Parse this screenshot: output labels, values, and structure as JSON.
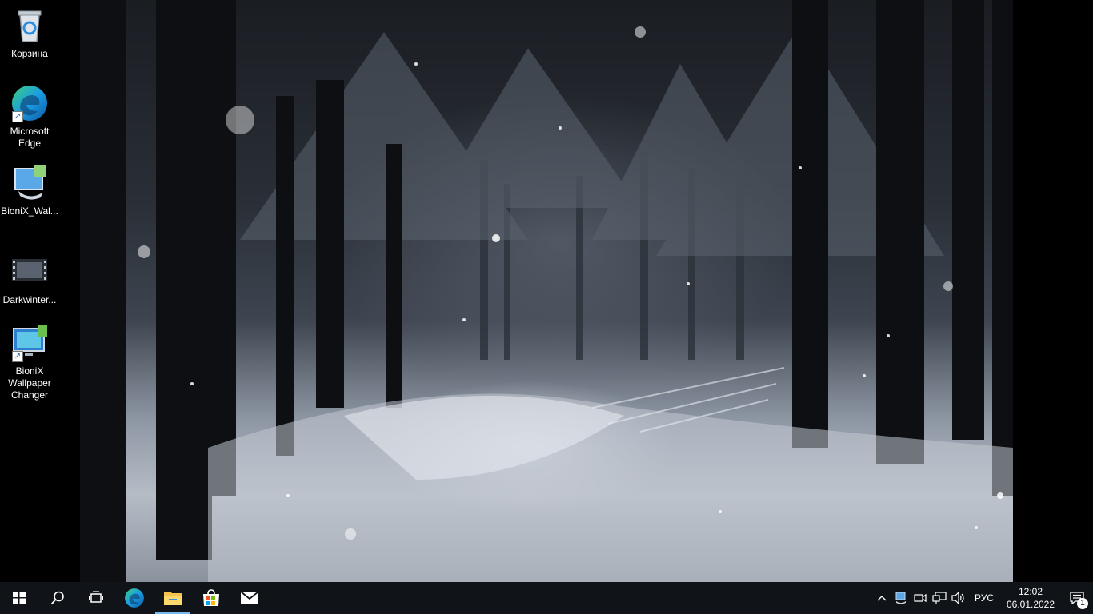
{
  "desktop": {
    "icons": [
      {
        "label": "Корзина",
        "icon": "recycle-bin-icon"
      },
      {
        "label": "Microsoft Edge",
        "icon": "edge-icon"
      },
      {
        "label": "BioniX_Wal...",
        "icon": "bionix-app-icon"
      },
      {
        "label": "Darkwinter...",
        "icon": "video-file-icon"
      },
      {
        "label": "BioniX Wallpaper Changer",
        "icon": "bionix-wallpaper-changer-icon"
      }
    ]
  },
  "taskbar": {
    "pinned": [
      {
        "name": "start",
        "icon": "windows-logo-icon"
      },
      {
        "name": "search",
        "icon": "search-icon"
      },
      {
        "name": "task-view",
        "icon": "task-view-icon"
      },
      {
        "name": "edge",
        "icon": "edge-icon"
      },
      {
        "name": "file-explorer",
        "icon": "folder-icon",
        "active": true
      },
      {
        "name": "store",
        "icon": "store-icon"
      },
      {
        "name": "mail",
        "icon": "mail-icon"
      }
    ],
    "tray": {
      "language": "РУС",
      "time": "12:02",
      "date": "06.01.2022",
      "notification_count": "1"
    }
  },
  "colors": {
    "taskbar": "#101418",
    "accent": "#76b9ed"
  }
}
